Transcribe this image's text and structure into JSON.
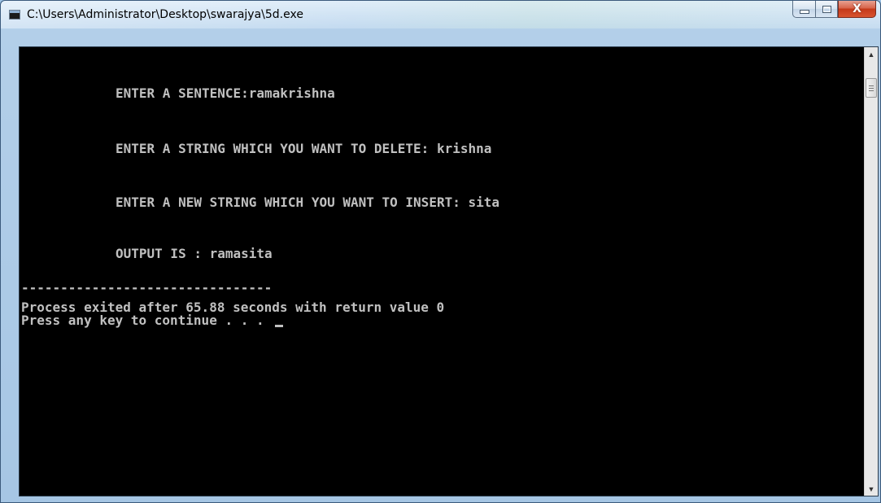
{
  "window": {
    "title": "C:\\Users\\Administrator\\Desktop\\swarajya\\5d.exe",
    "icon": "console-app-icon",
    "buttons": {
      "minimize": "minimize-icon",
      "maximize": "maximize-icon",
      "close": "X"
    }
  },
  "console": {
    "background": "#000000",
    "foreground": "#c0c0c0",
    "lines": {
      "prompt_sentence": "ENTER A SENTENCE:ramakrishna",
      "prompt_delete": "ENTER A STRING WHICH YOU WANT TO DELETE: krishna",
      "prompt_insert": "ENTER A NEW STRING WHICH YOU WANT TO INSERT: sita",
      "output": "OUTPUT IS : ramasita",
      "separator": "--------------------------------",
      "exit_message": "Process exited after 65.88 seconds with return value 0",
      "continue_message": "Press any key to continue . . . "
    }
  },
  "scrollbar": {
    "up_arrow": "▲",
    "down_arrow": "▼"
  }
}
